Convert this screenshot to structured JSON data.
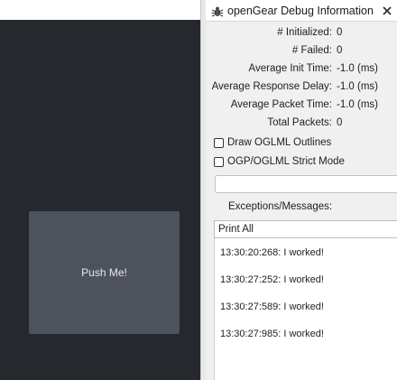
{
  "canvas": {
    "button_label": "Push Me!"
  },
  "debug_panel": {
    "title": "openGear Debug Information",
    "stats": [
      {
        "label": "# Initialized:",
        "value": "0"
      },
      {
        "label": "# Failed:",
        "value": "0"
      },
      {
        "label": "Average Init Time:",
        "value": "-1.0 (ms)"
      },
      {
        "label": "Average Response Delay:",
        "value": "-1.0 (ms)"
      },
      {
        "label": "Average Packet Time:",
        "value": "-1.0 (ms)"
      },
      {
        "label": "Total Packets:",
        "value": "0"
      }
    ],
    "checkboxes": [
      {
        "label": "Draw OGLML Outlines",
        "checked": false
      },
      {
        "label": "OGP/OGLML Strict Mode",
        "checked": false
      }
    ],
    "message_input": {
      "value": ""
    },
    "exceptions_label": "Exceptions/Messages:",
    "filter_selected": "Print All",
    "log": [
      "13:30:20:268: I worked!",
      "13:30:27:252: I worked!",
      "13:30:27:589: I worked!",
      "13:30:27:985: I worked!"
    ]
  },
  "icons": {
    "title_icon": "bug-icon",
    "close_icon": "close-icon"
  }
}
